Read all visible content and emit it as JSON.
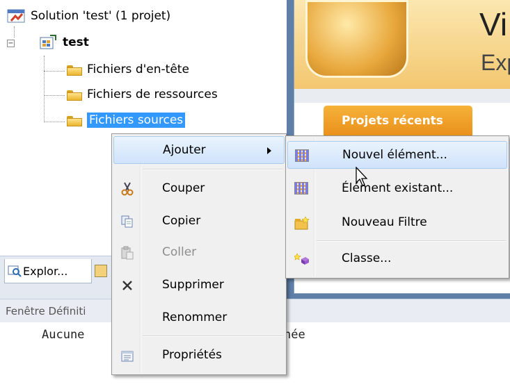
{
  "tree": {
    "solution_label": "Solution 'test' (1 projet)",
    "project_label": "test",
    "items": [
      {
        "label": "Fichiers d'en-tête"
      },
      {
        "label": "Fichiers de ressources"
      },
      {
        "label": "Fichiers sources"
      }
    ]
  },
  "start_page": {
    "title_partial": "Vi",
    "subtitle_partial": "Exp",
    "recent_projects_tab": "Projets récents"
  },
  "bottom_tabs": {
    "explorer_tab": "Explor..."
  },
  "definition_window": {
    "title_partial": "Fenêtre Définiti",
    "content": "Aucune                      ectionnée"
  },
  "context_menu": {
    "items": [
      {
        "label": "Ajouter",
        "icon": "none",
        "has_submenu": true
      },
      {
        "label": "Couper",
        "icon": "scissors-icon"
      },
      {
        "label": "Copier",
        "icon": "copy-icon"
      },
      {
        "label": "Coller",
        "icon": "paste-icon",
        "disabled": true
      },
      {
        "label": "Supprimer",
        "icon": "delete-icon"
      },
      {
        "label": "Renommer",
        "icon": "none"
      },
      {
        "label": "Propriétés",
        "icon": "properties-icon"
      }
    ]
  },
  "submenu": {
    "items": [
      {
        "label": "Nouvel élément...",
        "icon": "new-item-icon"
      },
      {
        "label": "Élément existant...",
        "icon": "existing-item-icon"
      },
      {
        "label": "Nouveau Filtre",
        "icon": "new-filter-icon"
      },
      {
        "label": "Classe...",
        "icon": "class-icon"
      }
    ]
  },
  "colors": {
    "selection": "#3399ff",
    "menu_bg": "#f0f0f0",
    "highlight": "#cfe3fb",
    "accent_orange": "#f0a030"
  }
}
